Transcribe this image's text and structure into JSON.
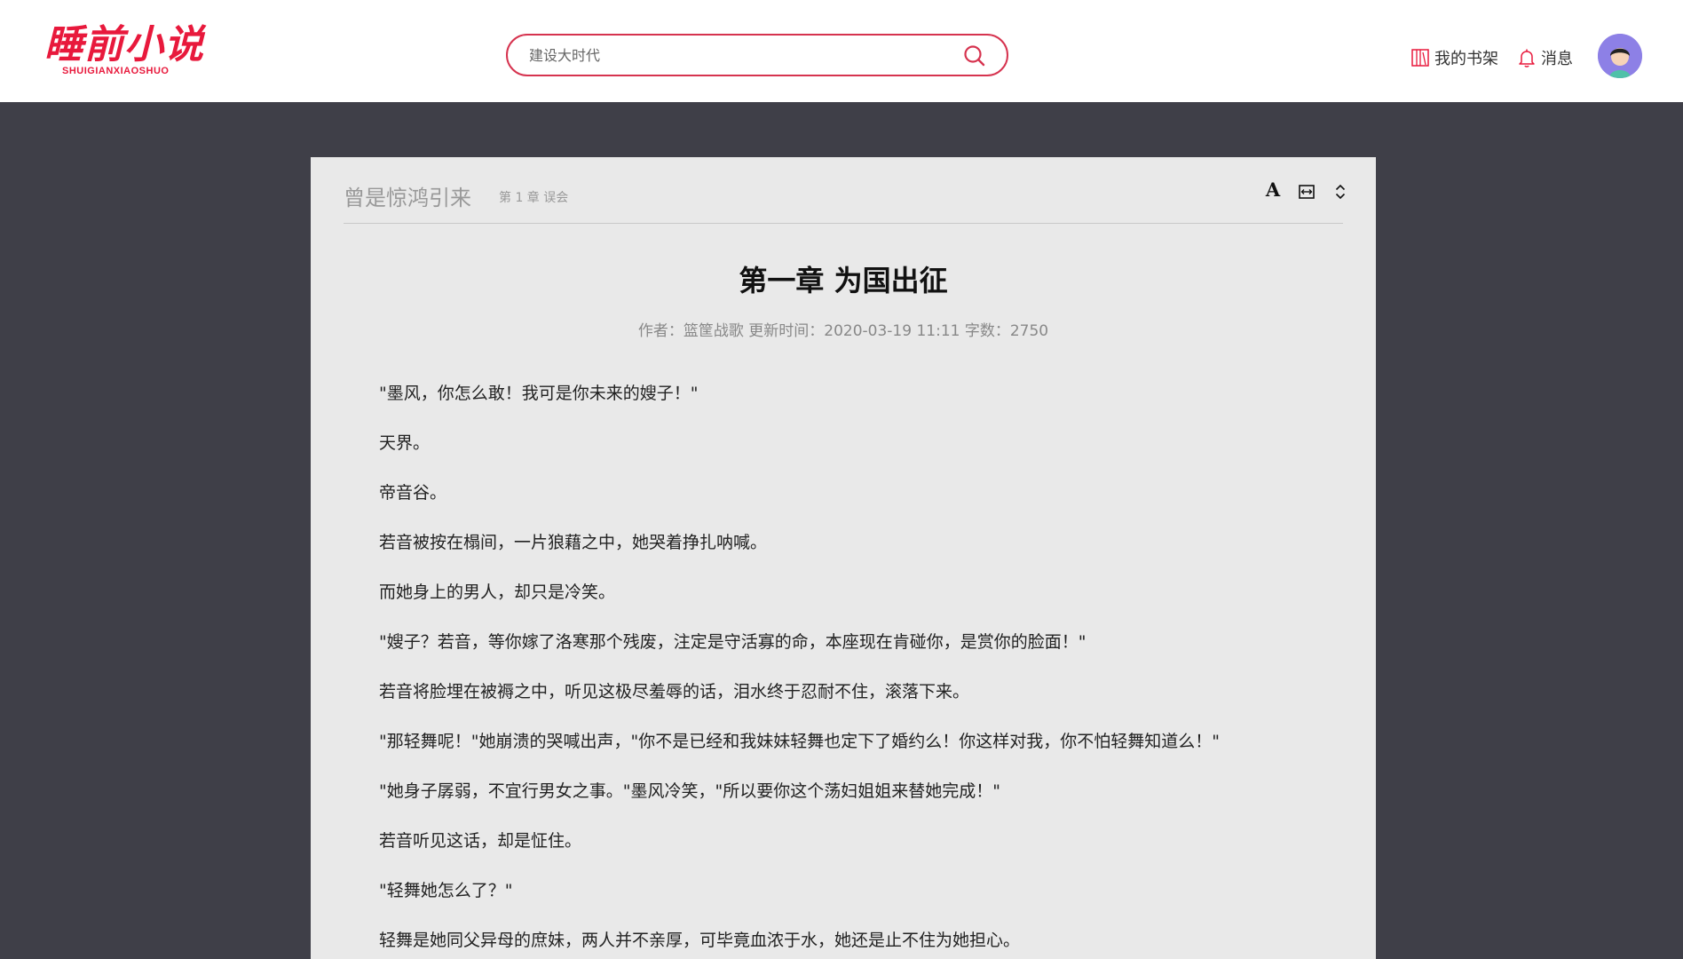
{
  "header": {
    "logo_text": "睡前小说",
    "logo_subtitle": "SHUIGIANXIAOSHUO",
    "search_placeholder": "建设大时代",
    "search_value": "",
    "nav": {
      "bookshelf_label": "我的书架",
      "messages_label": "消息"
    },
    "accent_color": "#e8193c"
  },
  "reader": {
    "book_title": "曾是惊鸿引来",
    "chapter_crumb": "第 1 章 误会",
    "tools": [
      "font-size-icon",
      "page-width-icon",
      "scroll-mode-icon"
    ],
    "chapter_title": "第一章 为国出征",
    "meta": "作者：篮筐战歌 更新时间：2020-03-19 11:11 字数：2750",
    "paragraphs": [
      "\"墨风，你怎么敢！我可是你未来的嫂子！\"",
      "天界。",
      "帝音谷。",
      "若音被按在榻间，一片狼藉之中，她哭着挣扎呐喊。",
      "而她身上的男人，却只是冷笑。",
      "\"嫂子？若音，等你嫁了洛寒那个残废，注定是守活寡的命，本座现在肯碰你，是赏你的脸面！\"",
      "若音将脸埋在被褥之中，听见这极尽羞辱的话，泪水终于忍耐不住，滚落下来。",
      "\"那轻舞呢！\"她崩溃的哭喊出声，\"你不是已经和我妹妹轻舞也定下了婚约么！你这样对我，你不怕轻舞知道么！\"",
      "\"她身子孱弱，不宜行男女之事。\"墨风冷笑，\"所以要你这个荡妇姐姐来替她完成！\"",
      "若音听见这话，却是怔住。",
      "\"轻舞她怎么了？\"",
      "轻舞是她同父异母的庶妹，两人并不亲厚，可毕竟血浓于水，她还是止不住为她担心。"
    ]
  }
}
